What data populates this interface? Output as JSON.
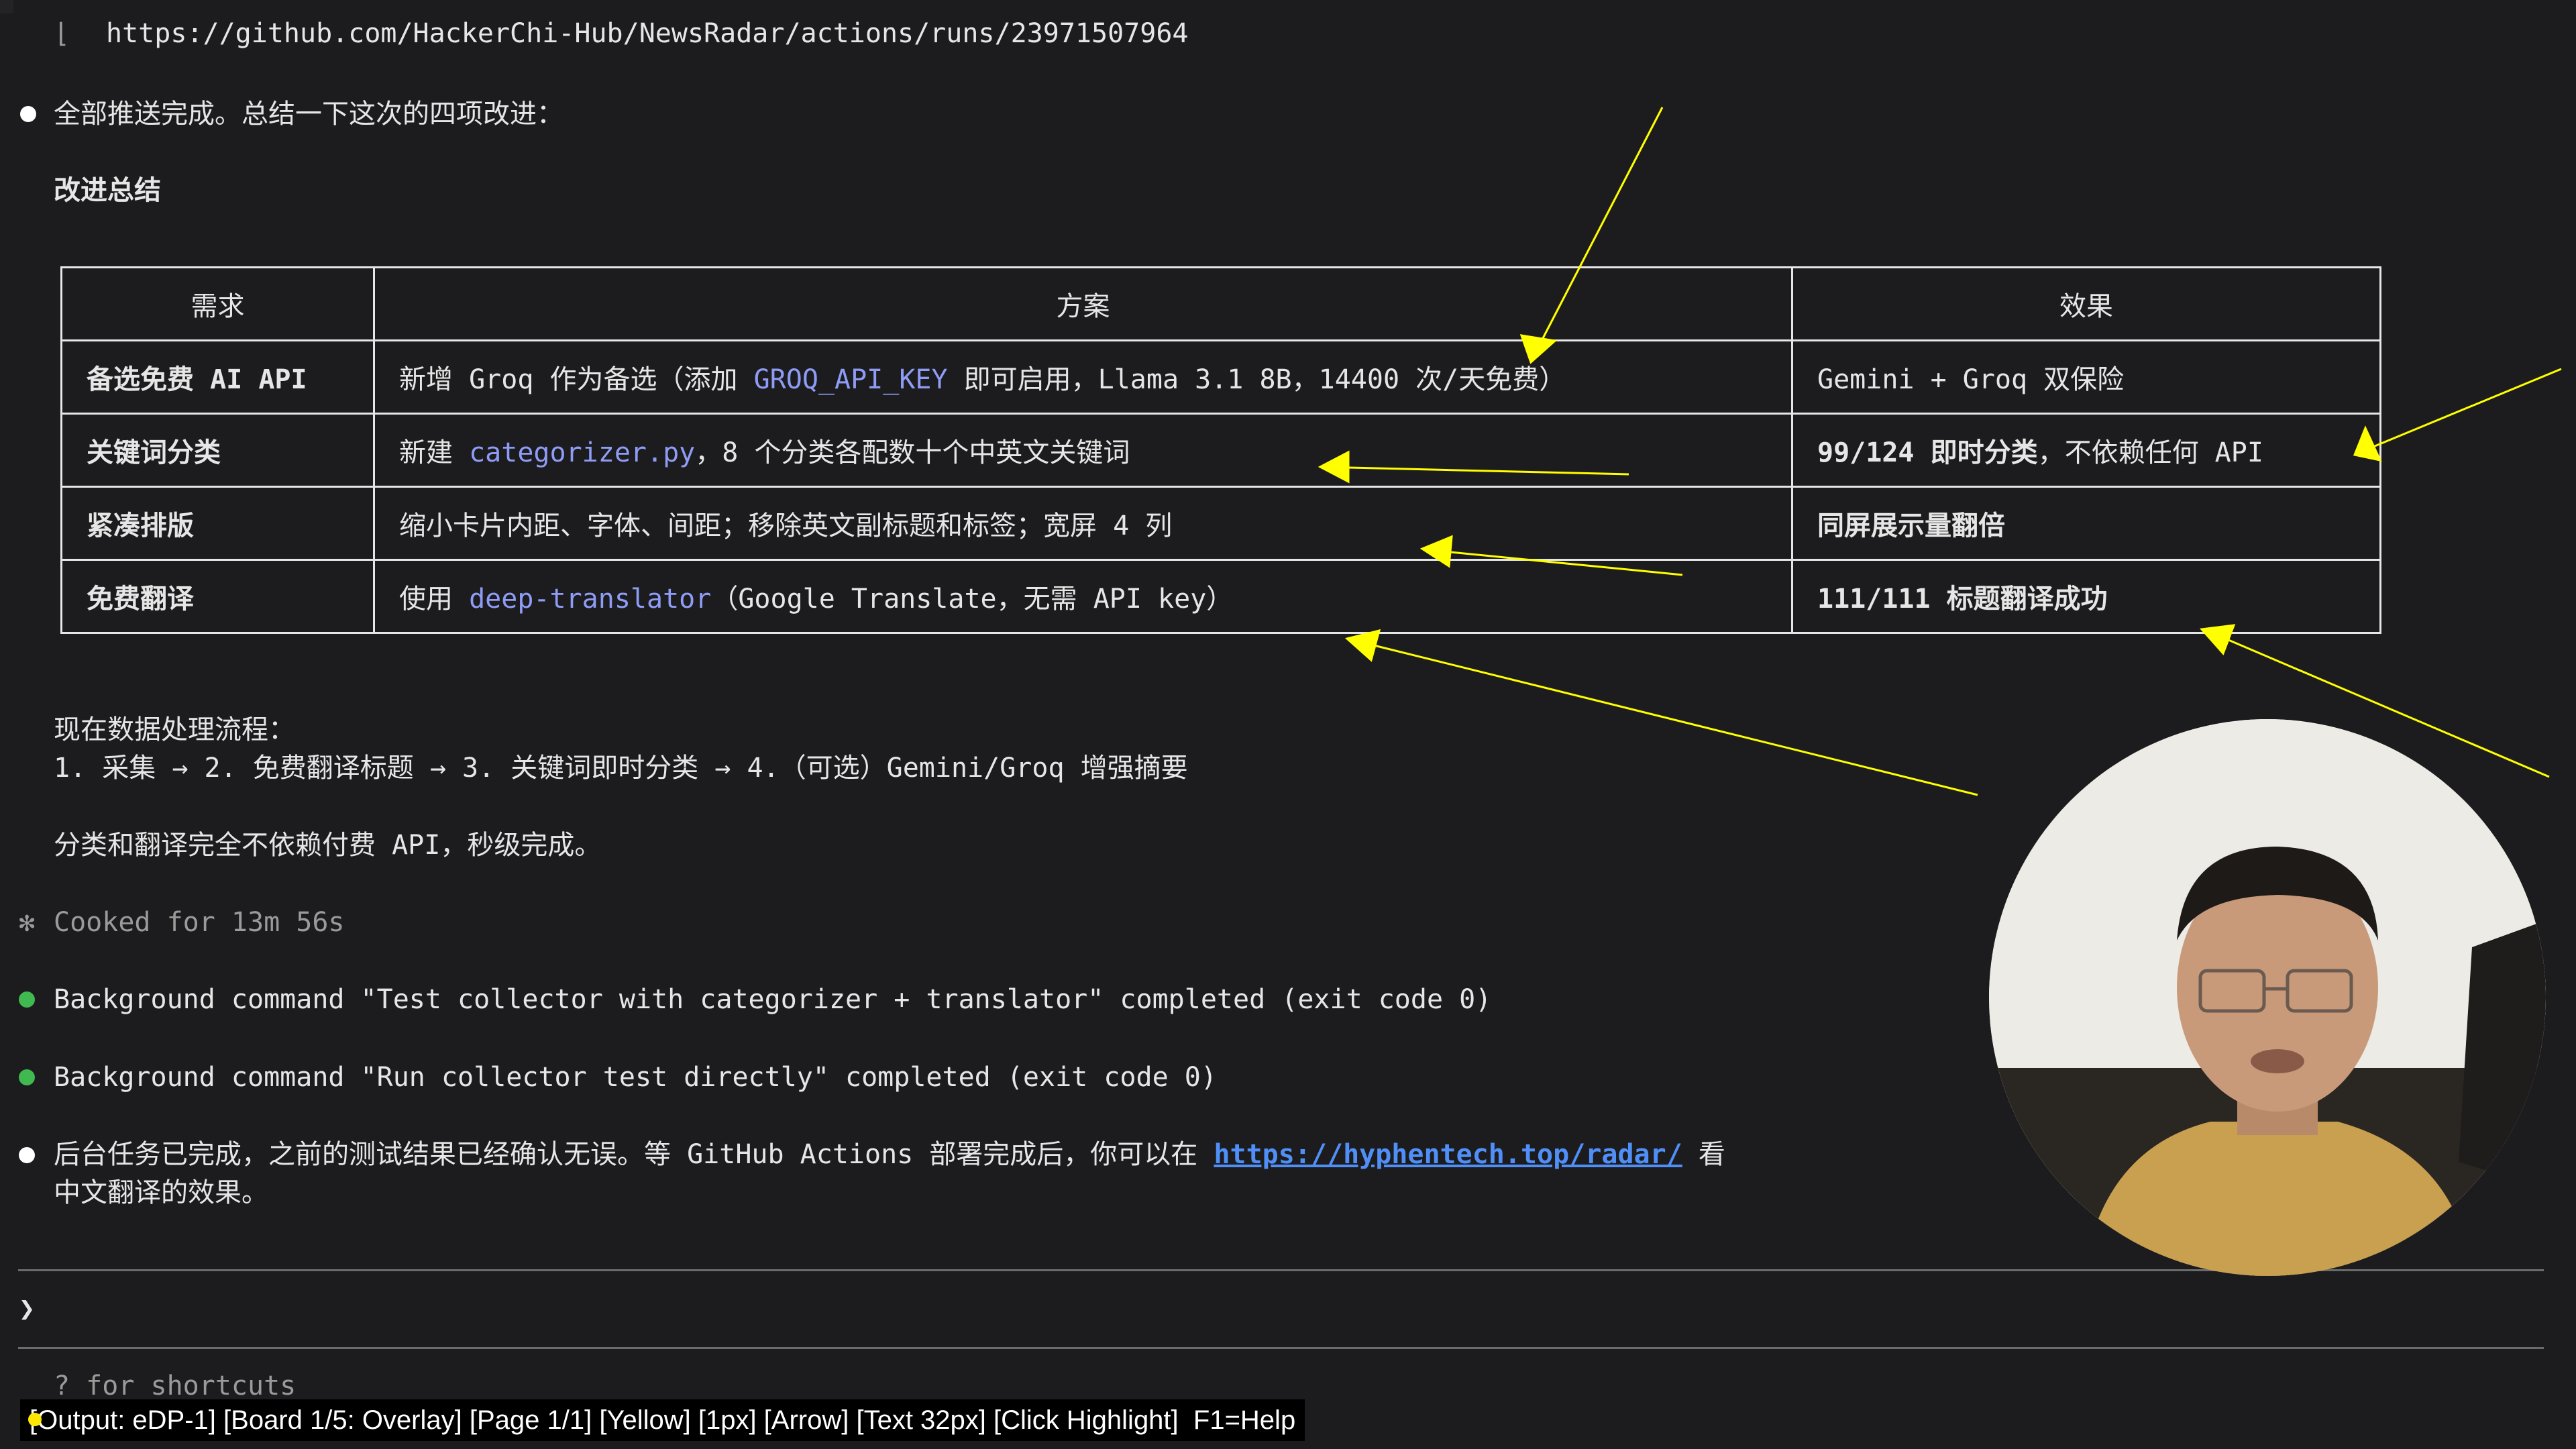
{
  "terminal": {
    "url_line": "https://github.com/HackerChi-Hub/NewsRadar/actions/runs/23971507964",
    "url_prefix": "⌊",
    "intro": "全部推送完成。总结一下这次的四项改进：",
    "section_title": "改进总结",
    "table": {
      "headers": [
        "需求",
        "方案",
        "效果"
      ],
      "rows": [
        {
          "req": "备选免费 AI API",
          "plan_pre": "新增 Groq 作为备选（添加 ",
          "plan_code": "GROQ_API_KEY",
          "plan_post": " 即可启用，Llama 3.1 8B，14400 次/天免费）",
          "effect_bold": "",
          "effect_rest": "Gemini + Groq 双保险"
        },
        {
          "req": "关键词分类",
          "plan_pre": "新建 ",
          "plan_code": "categorizer.py",
          "plan_post": "，8 个分类各配数十个中英文关键词",
          "effect_bold": "99/124 即时分类",
          "effect_rest": "，不依赖任何 API"
        },
        {
          "req": "紧凑排版",
          "plan_pre": "缩小卡片内距、字体、间距；移除英文副标题和标签；宽屏 4 列",
          "plan_code": "",
          "plan_post": "",
          "effect_bold": "同屏展示量翻倍",
          "effect_rest": ""
        },
        {
          "req": "免费翻译",
          "plan_pre": "使用 ",
          "plan_code": "deep-translator",
          "plan_post": "（Google Translate，无需 API key）",
          "effect_bold": "111/111 标题翻译成功",
          "effect_rest": ""
        }
      ]
    },
    "flow_title": "现在数据处理流程：",
    "flow_steps": "1. 采集 → 2. 免费翻译标题 → 3. 关键词即时分类 → 4.（可选）Gemini/Groq 增强摘要",
    "flow_note": "分类和翻译完全不依赖付费 API，秒级完成。",
    "cooked_symbol": "✻",
    "cooked": "Cooked for 13m 56s",
    "bg_cmd_1": "Background command \"Test collector with categorizer + translator\" completed (exit code 0)",
    "bg_cmd_2": "Background command \"Run collector test directly\" completed (exit code 0)",
    "final_pre": "后台任务已完成，之前的测试结果已经确认无误。等 GitHub Actions 部署完成后，你可以在 ",
    "final_link": "https://hyphentech.top/radar/",
    "final_post": " 看",
    "final_line2": "中文翻译的效果。",
    "prompt_symbol": "❯",
    "shortcuts_hint": "? for shortcuts"
  },
  "status_bar": {
    "text": "[Output: eDP-1] [Board 1/5: Overlay] [Page 1/1] [Yellow] [1px] [Arrow] [Text 32px] [Click Highlight]  F1=Help"
  },
  "colors": {
    "background": "#1c1c1e",
    "annotation": "#ffff00",
    "code": "#8f9cf6",
    "link": "#4f8ff7",
    "success_bullet": "#3fb950"
  },
  "webcam": {
    "icon": "person-video-feed"
  }
}
